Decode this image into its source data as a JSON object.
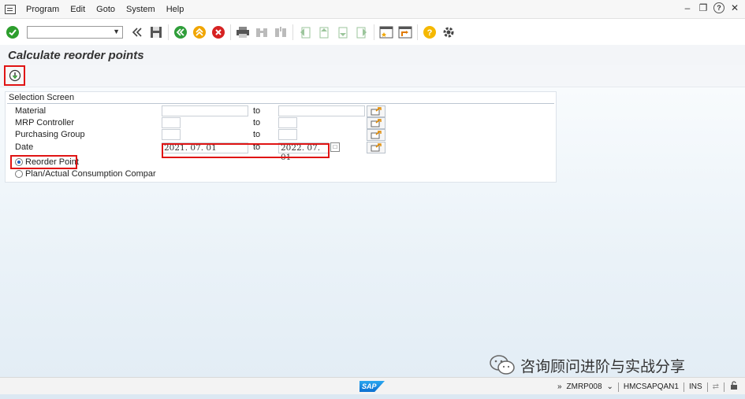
{
  "menu": {
    "items": [
      "Program",
      "Edit",
      "Goto",
      "System",
      "Help"
    ]
  },
  "toolbar": {
    "command_field_value": "",
    "icons": [
      "enter-icon",
      "back-double-icon",
      "save-icon",
      "back-icon",
      "exit-icon",
      "cancel-icon",
      "print-icon",
      "find-icon",
      "find-next-icon",
      "first-page-icon",
      "previous-page-icon",
      "next-page-icon",
      "last-page-icon",
      "create-session-icon",
      "shortcut-icon",
      "help-icon",
      "settings-icon"
    ]
  },
  "page": {
    "title": "Calculate reorder points"
  },
  "selection": {
    "title": "Selection Screen",
    "to_label": "to",
    "rows": [
      {
        "label": "Material",
        "from": "",
        "to": ""
      },
      {
        "label": "MRP Controller",
        "from": "",
        "to": ""
      },
      {
        "label": "Purchasing Group",
        "from": "",
        "to": ""
      },
      {
        "label": "Date",
        "from": "2021. 07. 01",
        "to": "2022. 07. 01"
      }
    ],
    "radios": [
      {
        "label": "Reorder Point",
        "checked": true
      },
      {
        "label": "Plan/Actual Consumption Compar",
        "checked": false
      }
    ]
  },
  "watermark": {
    "text": "咨询顾问进阶与实战分享"
  },
  "status": {
    "logo_text": "SAP",
    "transaction": "ZMRP008",
    "server": "HMCSAPQAN1",
    "mode": "INS"
  },
  "colors": {
    "highlight": "#e01414",
    "enter_green": "#2d9e2d",
    "nav_green": "#2f9e3a",
    "exit_orange": "#f0a500",
    "cancel_red": "#d62222",
    "help_yellow": "#f5b800"
  }
}
